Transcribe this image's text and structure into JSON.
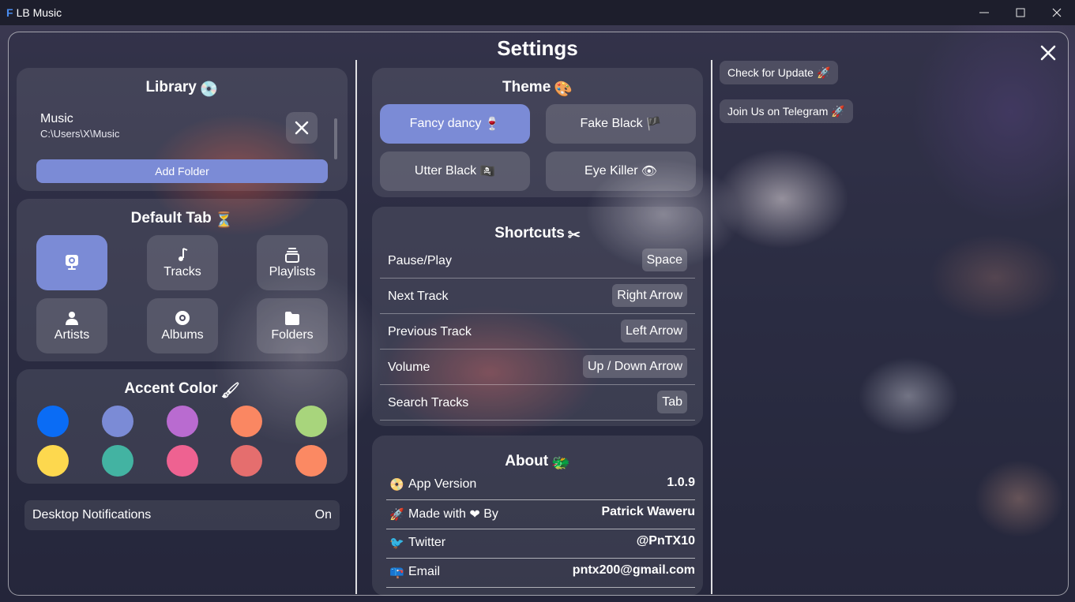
{
  "window": {
    "app_logo": "F",
    "app_title": "LB Music",
    "minimize_symbol": "—",
    "close_symbol": "✕"
  },
  "settings": {
    "title": "Settings"
  },
  "library": {
    "title": "Library",
    "title_emoji": "💿",
    "folder_name": "Music",
    "folder_path": "C:\\Users\\X\\Music",
    "add_folder_label": "Add Folder"
  },
  "default_tab": {
    "title": "Default Tab",
    "title_emoji": "⏳",
    "tabs": [
      {
        "label": "",
        "icon": "webcam-icon",
        "active": true
      },
      {
        "label": "Tracks",
        "icon": "music-note-icon",
        "active": false
      },
      {
        "label": "Playlists",
        "icon": "playlist-icon",
        "active": false
      },
      {
        "label": "Artists",
        "icon": "person-icon",
        "active": false
      },
      {
        "label": "Albums",
        "icon": "disc-icon",
        "active": false
      },
      {
        "label": "Folders",
        "icon": "folder-icon",
        "active": false
      }
    ]
  },
  "accent": {
    "title": "Accent Color",
    "title_emoji": "🖌",
    "colors": [
      "#0a6cf5",
      "#7b8bd6",
      "#b96bd0",
      "#fa8762",
      "#a8d57c",
      "#fdd84e",
      "#43b3a2",
      "#ee6291",
      "#e56e6e",
      "#fb8963"
    ]
  },
  "notifications": {
    "label": "Desktop Notifications",
    "value": "On"
  },
  "theme": {
    "title": "Theme",
    "title_emoji": "🎨",
    "options": [
      {
        "label": "Fancy dancy",
        "emoji": "🍷",
        "active": true
      },
      {
        "label": "Fake Black",
        "emoji": "🏴",
        "active": false
      },
      {
        "label": "Utter Black",
        "emoji": "🏴‍☠️",
        "active": false
      },
      {
        "label": "Eye Killer",
        "emoji": "👁",
        "active": false
      }
    ]
  },
  "shortcuts": {
    "title": "Shortcuts",
    "title_emoji": "✂",
    "rows": [
      {
        "action": "Pause/Play",
        "key": "Space"
      },
      {
        "action": "Next Track",
        "key": "Right Arrow"
      },
      {
        "action": "Previous Track",
        "key": "Left Arrow"
      },
      {
        "action": "Volume",
        "key": "Up / Down Arrow"
      },
      {
        "action": "Search Tracks",
        "key": "Tab"
      }
    ]
  },
  "about": {
    "title": "About",
    "title_emoji": "🐲",
    "rows": [
      {
        "icon": "📀",
        "label": "App Version",
        "value": "1.0.9"
      },
      {
        "icon": "🚀",
        "label": "Made with",
        "label_icon": "❤",
        "label_suffix": "By",
        "value": "Patrick Waweru"
      },
      {
        "icon": "🐦",
        "label": "Twitter",
        "value": "@PnTX10"
      },
      {
        "icon": "📪",
        "label": "Email",
        "value": "pntx200@gmail.com"
      }
    ]
  },
  "side": {
    "update_label": "Check for Update",
    "update_emoji": "🚀",
    "telegram_label": "Join Us on Telegram",
    "telegram_emoji": "🚀"
  }
}
